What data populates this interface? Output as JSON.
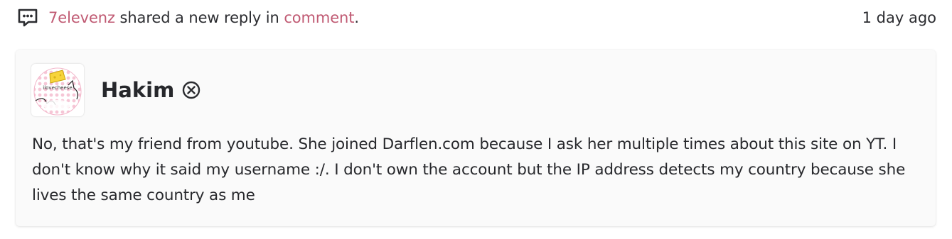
{
  "activity": {
    "username": "7elevenz",
    "action_text": " shared a new reply in ",
    "target_link": "comment",
    "period": ".",
    "timestamp": "1 day ago",
    "icon": "comment-dots-icon",
    "link_color": "#c05a73"
  },
  "reply": {
    "author_name": "Hakim",
    "badge_icon": "circled-x-icon",
    "avatar_icon": "cheese-cat-avatar",
    "avatar_text": "ilovecheese",
    "body": "No, that's my friend from youtube. She joined Darflen.com because I ask her multiple times about this site on YT. I don't know why it said my username :/. I don't own the account but the IP address detects my country because she lives the same country as me"
  }
}
